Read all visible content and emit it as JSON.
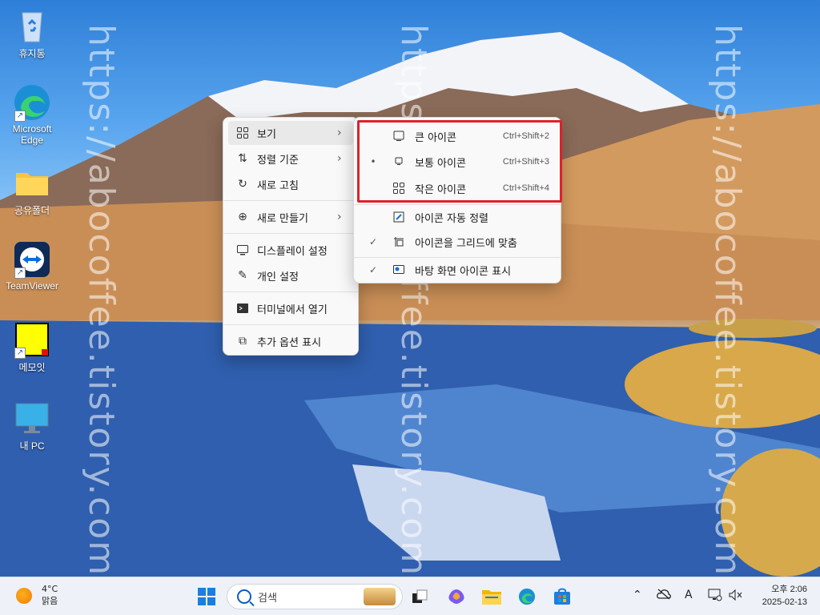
{
  "desktop": {
    "icons": [
      {
        "label": "휴지통"
      },
      {
        "label": "Microsoft Edge"
      },
      {
        "label": "공유폴더"
      },
      {
        "label": "TeamViewer"
      },
      {
        "label": "메모잇"
      },
      {
        "label": "내 PC"
      }
    ],
    "watermark": "https://abocoffee.tistory.com"
  },
  "context_menu": {
    "items": [
      {
        "label": "보기",
        "icon": "grid-icon",
        "has_submenu": true
      },
      {
        "label": "정렬 기준",
        "icon": "sort-icon",
        "has_submenu": true
      },
      {
        "label": "새로 고침",
        "icon": "refresh-icon"
      },
      {
        "label": "새로 만들기",
        "icon": "new-icon",
        "has_submenu": true
      },
      {
        "label": "디스플레이 설정",
        "icon": "display-icon"
      },
      {
        "label": "개인 설정",
        "icon": "brush-icon"
      },
      {
        "label": "터미널에서 열기",
        "icon": "terminal-icon"
      },
      {
        "label": "추가 옵션 표시",
        "icon": "more-options-icon"
      }
    ]
  },
  "view_submenu": {
    "items": [
      {
        "label": "큰 아이콘",
        "shortcut": "Ctrl+Shift+2",
        "mark": ""
      },
      {
        "label": "보통 아이콘",
        "shortcut": "Ctrl+Shift+3",
        "mark": "•"
      },
      {
        "label": "작은 아이콘",
        "shortcut": "Ctrl+Shift+4",
        "mark": ""
      },
      {
        "label": "아이콘 자동 정렬",
        "shortcut": "",
        "mark": ""
      },
      {
        "label": "아이콘을 그리드에 맞춤",
        "shortcut": "",
        "mark": "✓"
      },
      {
        "label": "바탕 화면 아이콘 표시",
        "shortcut": "",
        "mark": "✓"
      }
    ]
  },
  "taskbar": {
    "weather_temp": "4°C",
    "weather_desc": "맑음",
    "search_placeholder": "검색",
    "time": "오후 2:06",
    "date": "2025-02-13",
    "ime": "A"
  },
  "colors": {
    "highlight_box": "#e0202c",
    "taskbar_bg": "#eef2f8"
  }
}
